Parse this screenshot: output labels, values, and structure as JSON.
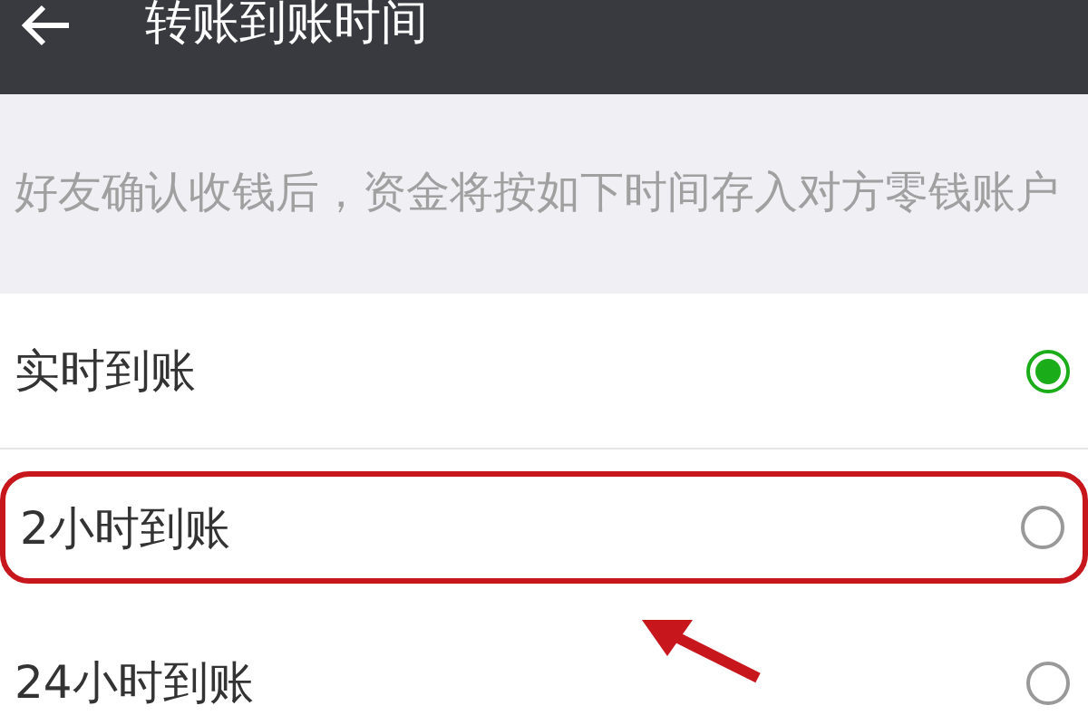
{
  "header": {
    "title": "转账到账时间"
  },
  "description": "好友确认收钱后，资金将按如下时间存入对方零钱账户",
  "options": [
    {
      "label": "实时到账",
      "selected": true,
      "highlighted": false
    },
    {
      "label": "2小时到账",
      "selected": false,
      "highlighted": true
    },
    {
      "label": "24小时到账",
      "selected": false,
      "highlighted": false
    }
  ]
}
